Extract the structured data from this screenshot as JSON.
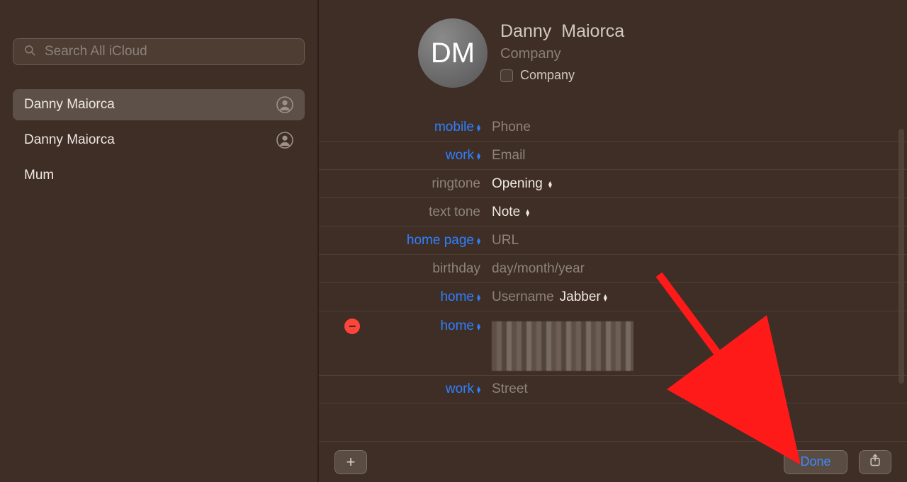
{
  "search": {
    "placeholder": "Search All iCloud"
  },
  "sidebar": {
    "items": [
      {
        "name": "Danny  Maiorca",
        "silhouette": true,
        "selected": true
      },
      {
        "name": "Danny Maiorca",
        "silhouette": true,
        "selected": false
      },
      {
        "name": "Mum",
        "silhouette": false,
        "selected": false
      }
    ]
  },
  "contact": {
    "initials": "DM",
    "first": "Danny",
    "last": "Maiorca",
    "company_placeholder": "Company",
    "company_checkbox_label": "Company"
  },
  "fields": {
    "mobile": {
      "label": "mobile",
      "placeholder": "Phone"
    },
    "workemail": {
      "label": "work",
      "placeholder": "Email"
    },
    "ringtone": {
      "label": "ringtone",
      "value": "Opening"
    },
    "texttone": {
      "label": "text tone",
      "value": "Note"
    },
    "homepage": {
      "label": "home page",
      "placeholder": "URL"
    },
    "birthday": {
      "label": "birthday",
      "placeholder": "day/month/year"
    },
    "im": {
      "label": "home",
      "placeholder": "Username",
      "service": "Jabber"
    },
    "addr_home": {
      "label": "home",
      "redacted": true
    },
    "addr_work": {
      "label": "work",
      "placeholder": "Street"
    }
  },
  "toolbar": {
    "done": "Done"
  }
}
